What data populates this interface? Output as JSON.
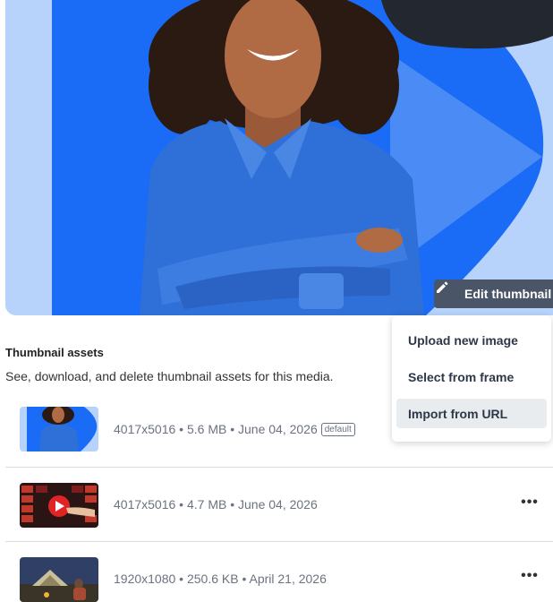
{
  "preview": {
    "edit_button_label": "Edit thumbnail",
    "edit_icon": "pencil-icon",
    "colors": {
      "light_blue": "#b7d3fb",
      "brand_blue": "#1a6bf5",
      "shirt_blue": "#2f6fd8",
      "dark_accent": "#23272f",
      "button_bg": "#4a5568"
    }
  },
  "section": {
    "title": "Thumbnail assets",
    "description": "See, download, and delete thumbnail assets for this media."
  },
  "assets": [
    {
      "meta": "4017x5016 • 5.6 MB • June 04, 2026",
      "badge": "default",
      "thumbnail": "woman-blue-shirt"
    },
    {
      "meta": "4017x5016 • 4.7 MB • June 04, 2026",
      "thumbnail": "play-button-collage"
    },
    {
      "meta": "1920x1080 • 250.6 KB • April 21, 2026",
      "thumbnail": "campsite-tent"
    }
  ],
  "more_icon": "more-horizontal-icon",
  "menu": {
    "items": [
      {
        "label": "Upload new image"
      },
      {
        "label": "Select from frame"
      },
      {
        "label": "Import from URL",
        "highlighted": true
      }
    ]
  }
}
